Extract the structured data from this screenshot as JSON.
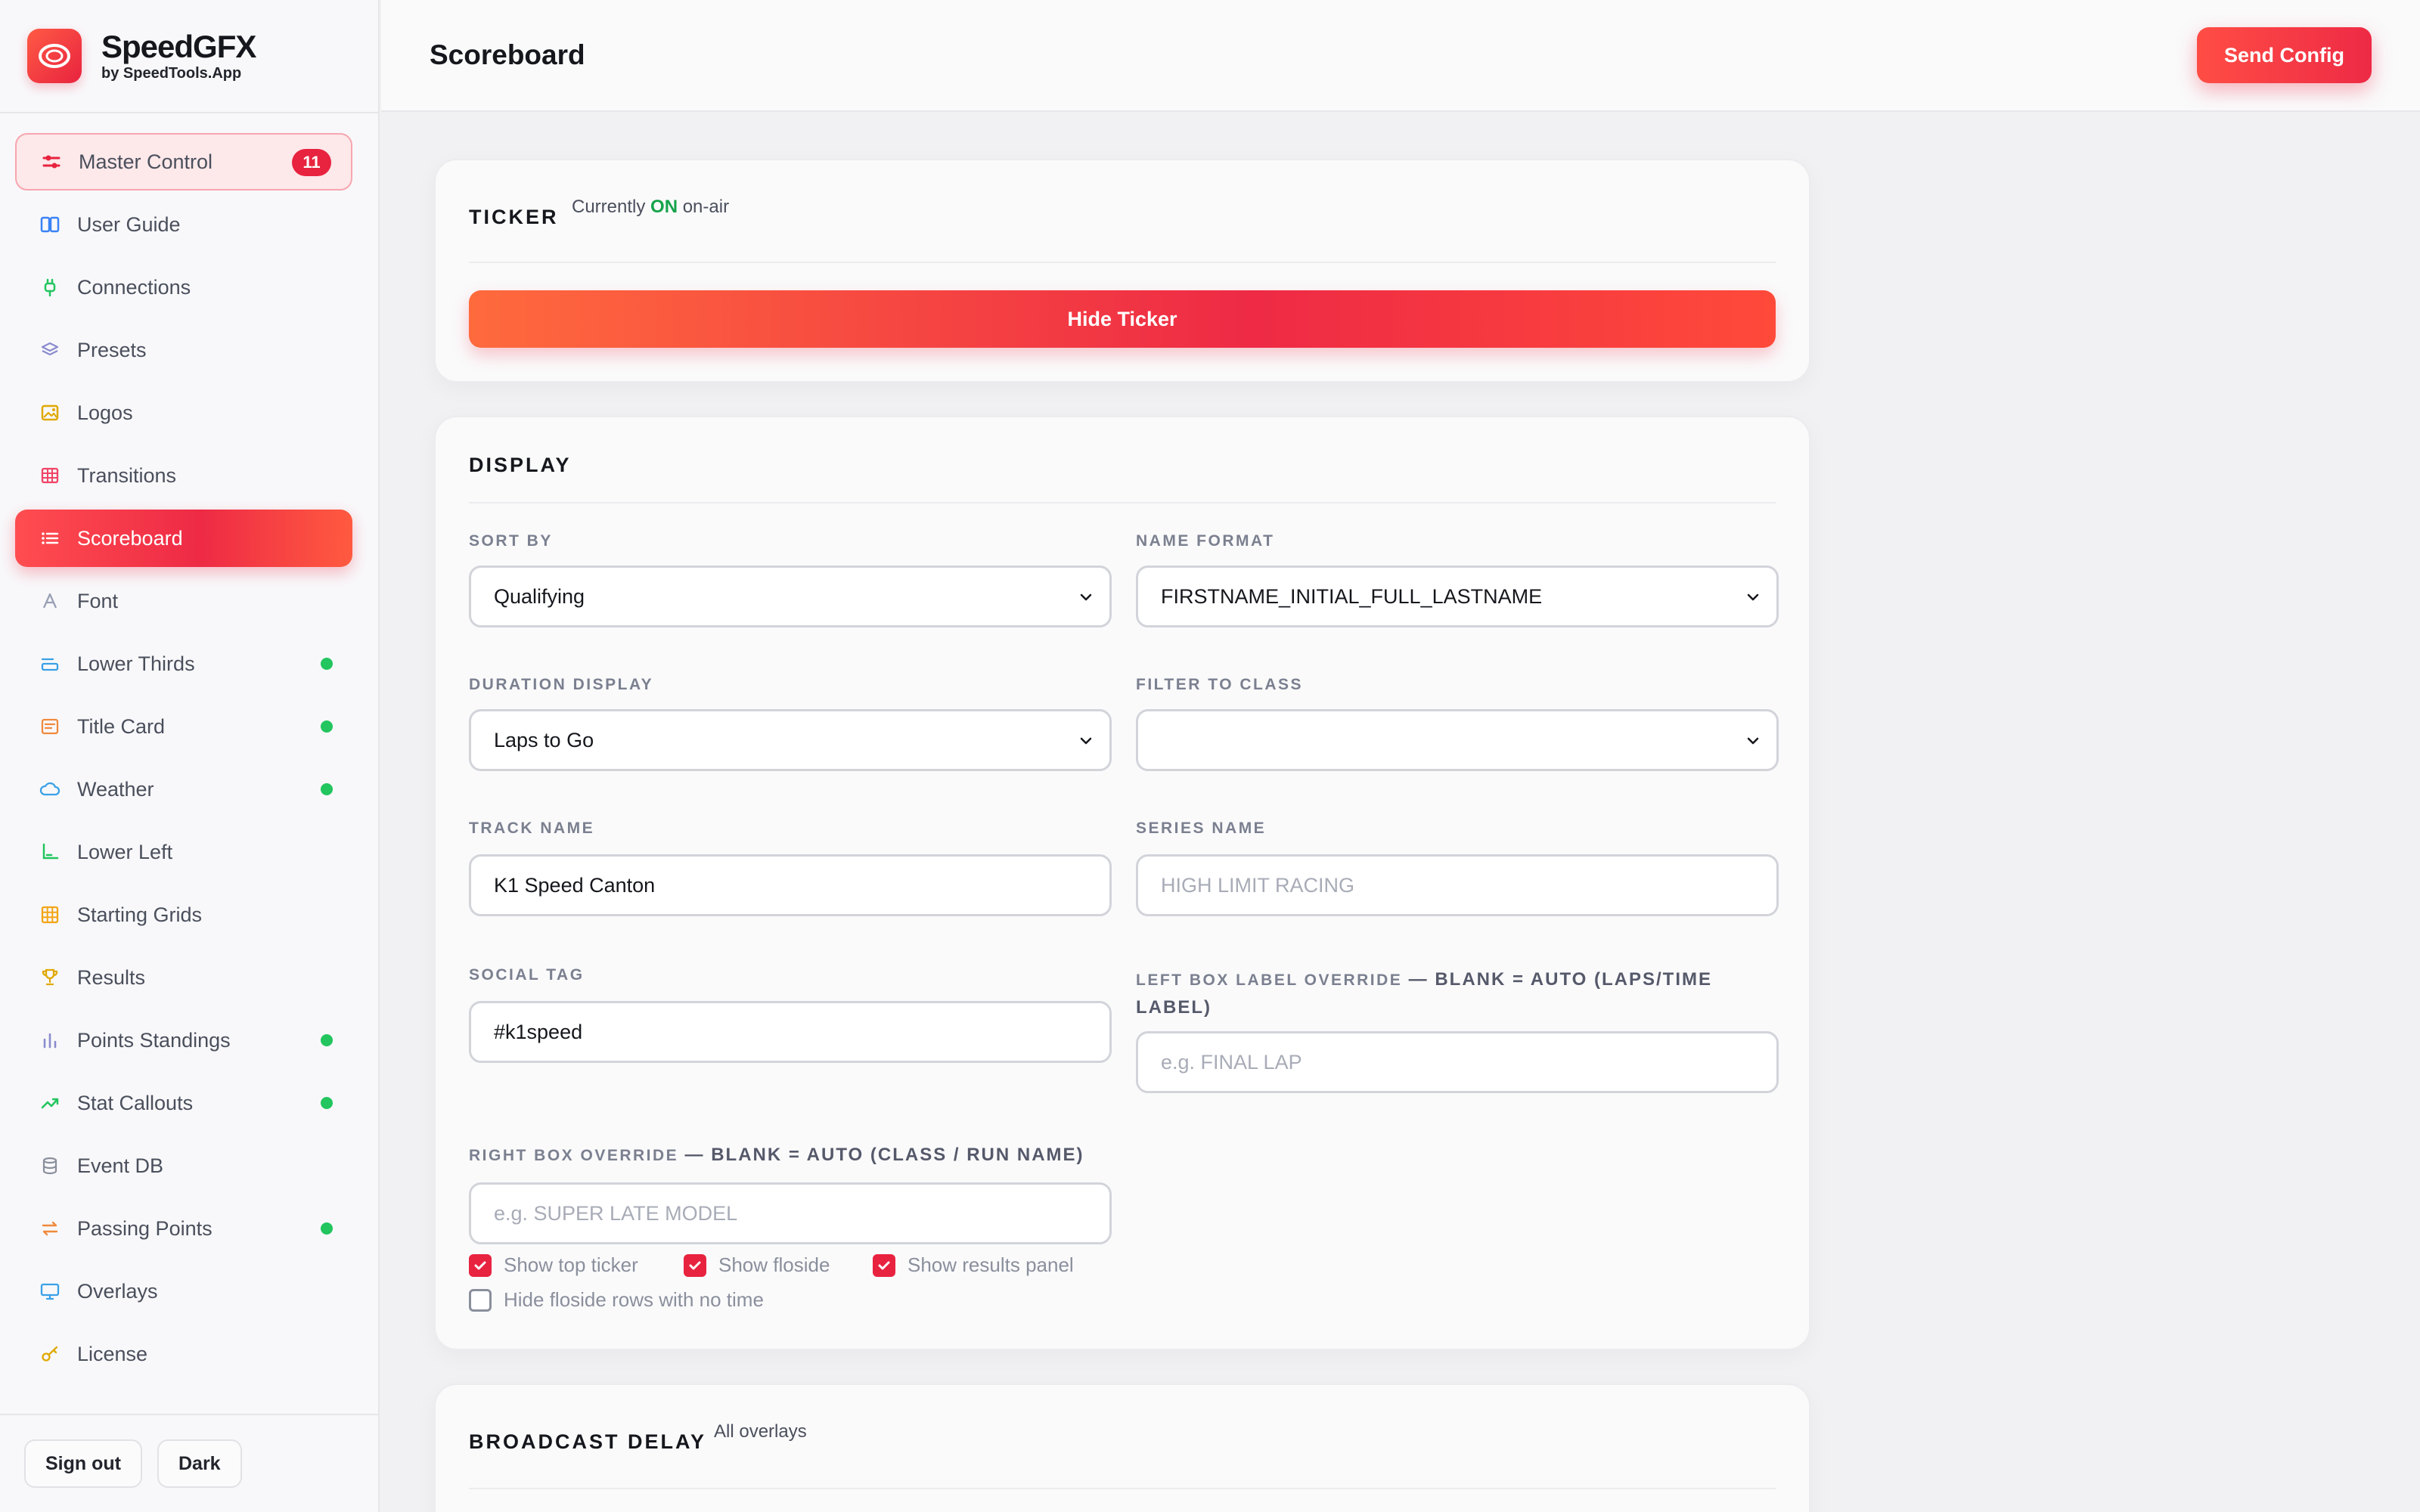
{
  "brand": {
    "name": "SpeedGFX",
    "sub": "by SpeedTools.App"
  },
  "sidebar": {
    "items": [
      {
        "label": "Master Control",
        "icon": "sliders-icon",
        "badge": "11",
        "state": "soft"
      },
      {
        "label": "User Guide",
        "icon": "book-icon"
      },
      {
        "label": "Connections",
        "icon": "plug-icon"
      },
      {
        "label": "Presets",
        "icon": "layers-icon"
      },
      {
        "label": "Logos",
        "icon": "image-icon"
      },
      {
        "label": "Transitions",
        "icon": "grid-icon"
      },
      {
        "label": "Scoreboard",
        "icon": "list-icon",
        "state": "active"
      },
      {
        "label": "Font",
        "icon": "font-icon"
      },
      {
        "label": "Lower Thirds",
        "icon": "lower-thirds-icon",
        "dot": true
      },
      {
        "label": "Title Card",
        "icon": "title-card-icon",
        "dot": true
      },
      {
        "label": "Weather",
        "icon": "cloud-icon",
        "dot": true
      },
      {
        "label": "Lower Left",
        "icon": "corner-icon"
      },
      {
        "label": "Starting Grids",
        "icon": "starting-grid-icon"
      },
      {
        "label": "Results",
        "icon": "trophy-icon"
      },
      {
        "label": "Points Standings",
        "icon": "bar-chart-icon",
        "dot": true
      },
      {
        "label": "Stat Callouts",
        "icon": "trend-icon",
        "dot": true
      },
      {
        "label": "Event DB",
        "icon": "database-icon"
      },
      {
        "label": "Passing Points",
        "icon": "swap-icon",
        "dot": true
      },
      {
        "label": "Overlays",
        "icon": "monitor-icon"
      },
      {
        "label": "License",
        "icon": "key-icon"
      }
    ],
    "footer": {
      "sign_out": "Sign out",
      "theme": "Dark"
    }
  },
  "header": {
    "title": "Scoreboard",
    "send": "Send Config"
  },
  "ticker": {
    "title": "TICKER",
    "status_prefix": "Currently",
    "status_value": "ON",
    "status_suffix": "on-air",
    "button": "Hide Ticker"
  },
  "display": {
    "title": "DISPLAY",
    "sort_by": {
      "label": "SORT BY",
      "value": "Qualifying"
    },
    "name_format": {
      "label": "NAME FORMAT",
      "value": "FIRSTNAME_INITIAL_FULL_LASTNAME"
    },
    "duration_display": {
      "label": "DURATION DISPLAY",
      "value": "Laps to Go"
    },
    "filter_to_class": {
      "label": "FILTER TO CLASS",
      "value": ""
    },
    "track_name": {
      "label": "TRACK NAME",
      "value": "K1 Speed Canton"
    },
    "series_name": {
      "label": "SERIES NAME",
      "placeholder": "HIGH LIMIT RACING"
    },
    "social_tag": {
      "label": "SOCIAL TAG",
      "value": "#k1speed"
    },
    "left_box": {
      "label": "LEFT BOX LABEL OVERRIDE",
      "label_strong": "— BLANK = AUTO (LAPS/TIME LABEL)",
      "placeholder": "e.g. FINAL LAP"
    },
    "right_box": {
      "label": "RIGHT BOX OVERRIDE",
      "label_strong": "— BLANK = AUTO (CLASS / RUN NAME)",
      "placeholder": "e.g. SUPER LATE MODEL"
    },
    "checks": [
      {
        "label": "Show top ticker",
        "checked": true
      },
      {
        "label": "Show floside",
        "checked": true
      },
      {
        "label": "Show results panel",
        "checked": true
      },
      {
        "label": "Hide floside rows with no time",
        "checked": false
      }
    ]
  },
  "broadcast": {
    "title": "BROADCAST DELAY",
    "sub": "All overlays"
  },
  "colors": {
    "accent": "#ee2a45",
    "success": "#22c55e",
    "on_text": "#16a34a"
  }
}
